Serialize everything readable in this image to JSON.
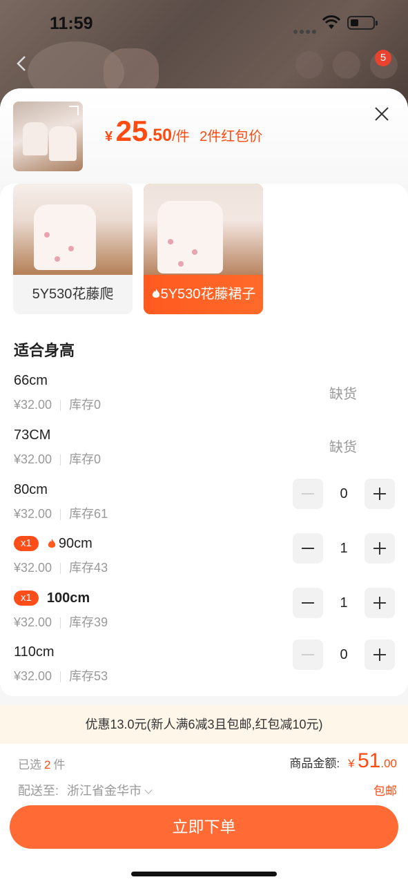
{
  "status_bar": {
    "time": "11:59"
  },
  "nav": {
    "cart_badge": "5"
  },
  "header": {
    "currency": "¥",
    "price_int": "25",
    "price_dec": ".50",
    "unit": "/件",
    "promo": "2件红包价"
  },
  "variants": [
    {
      "label": "5Y530花藤爬",
      "selected": false
    },
    {
      "label": "5Y530花藤裙子",
      "selected": true
    }
  ],
  "section_title": "适合身高",
  "sizes": [
    {
      "name": "66cm",
      "price": "¥32.00",
      "stock": "库存0",
      "status": "缺货"
    },
    {
      "name": "73CM",
      "price": "¥32.00",
      "stock": "库存0",
      "status": "缺货"
    },
    {
      "name": "80cm",
      "price": "¥32.00",
      "stock": "库存61",
      "qty": "0"
    },
    {
      "name": "90cm",
      "price": "¥32.00",
      "stock": "库存43",
      "qty": "1",
      "tag": "x1"
    },
    {
      "name": "100cm",
      "price": "¥32.00",
      "stock": "库存39",
      "qty": "1",
      "tag": "x1"
    },
    {
      "name": "110cm",
      "price": "¥32.00",
      "stock": "库存53",
      "qty": "0"
    }
  ],
  "promo_bar": "优惠13.0元(新人满6减3且包邮,红包减10元)",
  "footer": {
    "selected_prefix": "已选",
    "selected_count": "2",
    "selected_suffix": "件",
    "total_label": "商品金额:",
    "total_currency": "¥",
    "total_int": "51",
    "total_dec": ".00",
    "ship_label": "配送至:",
    "ship_address": "浙江省金华市",
    "free_shipping": "包邮",
    "order_button": "立即下单"
  },
  "colors": {
    "accent": "#ff4a10",
    "button": "#ff6a35",
    "promo_bg": "#fdf6e9"
  }
}
